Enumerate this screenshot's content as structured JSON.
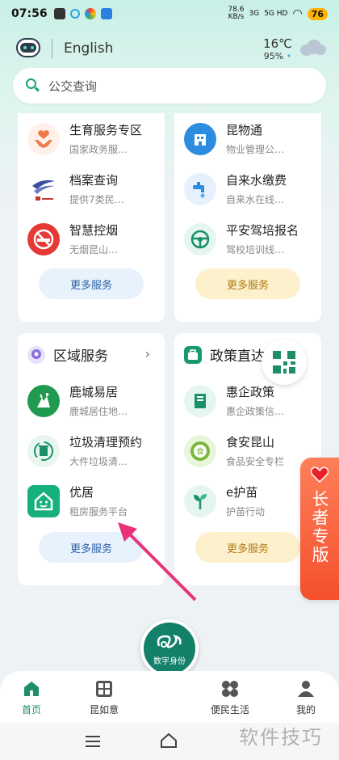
{
  "status_bar": {
    "time": "07:56",
    "net_speed": "78.6\nKB/s",
    "signal1": "3G",
    "signal2": "5G HD",
    "battery": "76"
  },
  "header": {
    "language_button": "English",
    "temperature": "16℃",
    "humidity": "95%"
  },
  "search": {
    "placeholder": "公交查询"
  },
  "top_left_card": {
    "items": [
      {
        "title": "生育服务专区",
        "subtitle": "国家政务服…"
      },
      {
        "title": "档案查询",
        "subtitle": "提供7类民…"
      },
      {
        "title": "智慧控烟",
        "subtitle": "无烟昆山…"
      }
    ],
    "more_label": "更多服务"
  },
  "top_right_card": {
    "items": [
      {
        "title": "昆物通",
        "subtitle": "物业管理公…"
      },
      {
        "title": "自来水缴费",
        "subtitle": "自来水在线…"
      },
      {
        "title": "平安驾培报名",
        "subtitle": "驾校培训线…"
      }
    ],
    "more_label": "更多服务"
  },
  "region_card": {
    "title": "区域服务",
    "items": [
      {
        "title": "鹿城易居",
        "subtitle": "鹿城居住地…"
      },
      {
        "title": "垃圾清理预约",
        "subtitle": "大件垃圾清…"
      },
      {
        "title": "优居",
        "subtitle": "租房服务平台"
      }
    ],
    "more_label": "更多服务"
  },
  "policy_card": {
    "title": "政策直达",
    "items": [
      {
        "title": "惠企政策",
        "subtitle": "惠企政策信…"
      },
      {
        "title": "食安昆山",
        "subtitle": "食品安全专栏"
      },
      {
        "title": "e护苗",
        "subtitle": "护苗行动"
      }
    ],
    "more_label": "更多服务"
  },
  "elder_mode": {
    "label": "长者专版"
  },
  "tabbar": {
    "tabs": [
      {
        "label": "首页"
      },
      {
        "label": "昆如意"
      },
      {
        "label": "便民生活"
      },
      {
        "label": "我的"
      }
    ],
    "center_label": "数字身份"
  },
  "watermark": "软件技巧",
  "colors": {
    "accent": "#1a8f6a",
    "elder_orange": "#f4502d",
    "more_blue": "#e8f2fc",
    "more_yellow": "#fdf0cc",
    "arrow": "#e8337a"
  }
}
